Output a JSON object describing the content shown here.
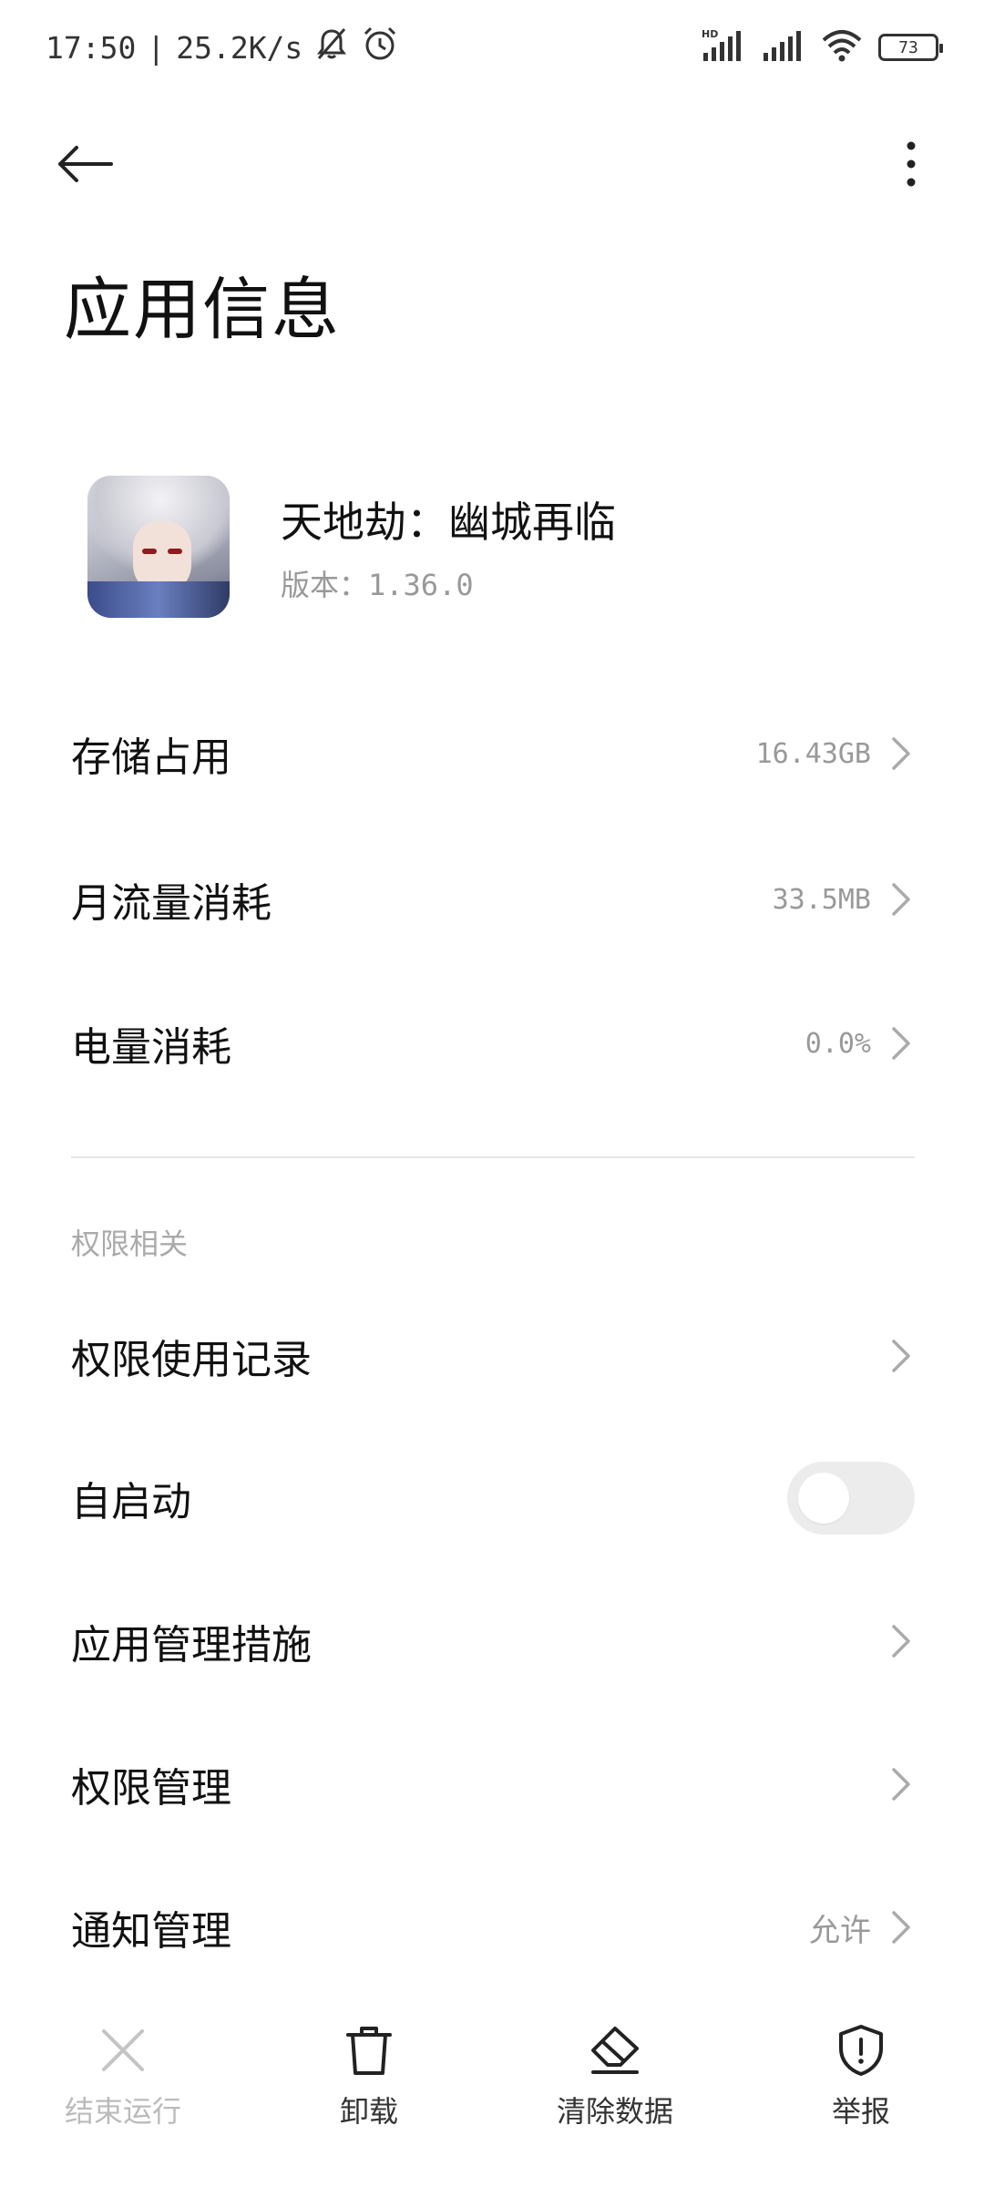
{
  "status_bar": {
    "time": "17:50",
    "separator": "|",
    "network_speed": "25.2K/s",
    "battery": "73"
  },
  "header": {
    "title": "应用信息"
  },
  "app": {
    "name": "天地劫：幽城再临",
    "version": "版本：1.36.0"
  },
  "usage": {
    "storage": {
      "label": "存储占用",
      "value": "16.43GB"
    },
    "data": {
      "label": "月流量消耗",
      "value": "33.5MB"
    },
    "battery": {
      "label": "电量消耗",
      "value": "0.0%"
    }
  },
  "permissions": {
    "section_label": "权限相关",
    "usage_record": {
      "label": "权限使用记录"
    },
    "autostart": {
      "label": "自启动",
      "enabled": false
    },
    "app_management": {
      "label": "应用管理措施"
    },
    "permission_management": {
      "label": "权限管理"
    },
    "notification": {
      "label": "通知管理",
      "value": "允许"
    }
  },
  "bottom_actions": {
    "force_stop": "结束运行",
    "uninstall": "卸载",
    "clear_data": "清除数据",
    "report": "举报"
  }
}
